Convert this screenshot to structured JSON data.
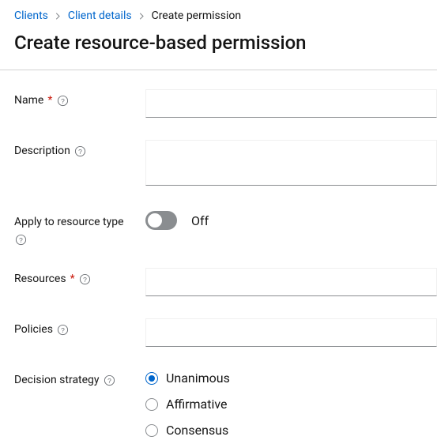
{
  "breadcrumb": {
    "items": [
      {
        "label": "Clients",
        "link": true
      },
      {
        "label": "Client details",
        "link": true
      },
      {
        "label": "Create permission",
        "link": false
      }
    ]
  },
  "page": {
    "title": "Create resource-based permission"
  },
  "form": {
    "name": {
      "label": "Name",
      "value": ""
    },
    "description": {
      "label": "Description",
      "value": ""
    },
    "apply_to_resource_type": {
      "label": "Apply to resource type",
      "toggle_label": "Off",
      "on": false
    },
    "resources": {
      "label": "Resources",
      "value": ""
    },
    "policies": {
      "label": "Policies",
      "value": ""
    },
    "decision_strategy": {
      "label": "Decision strategy",
      "options": [
        {
          "label": "Unanimous",
          "checked": true
        },
        {
          "label": "Affirmative",
          "checked": false
        },
        {
          "label": "Consensus",
          "checked": false
        }
      ]
    }
  }
}
